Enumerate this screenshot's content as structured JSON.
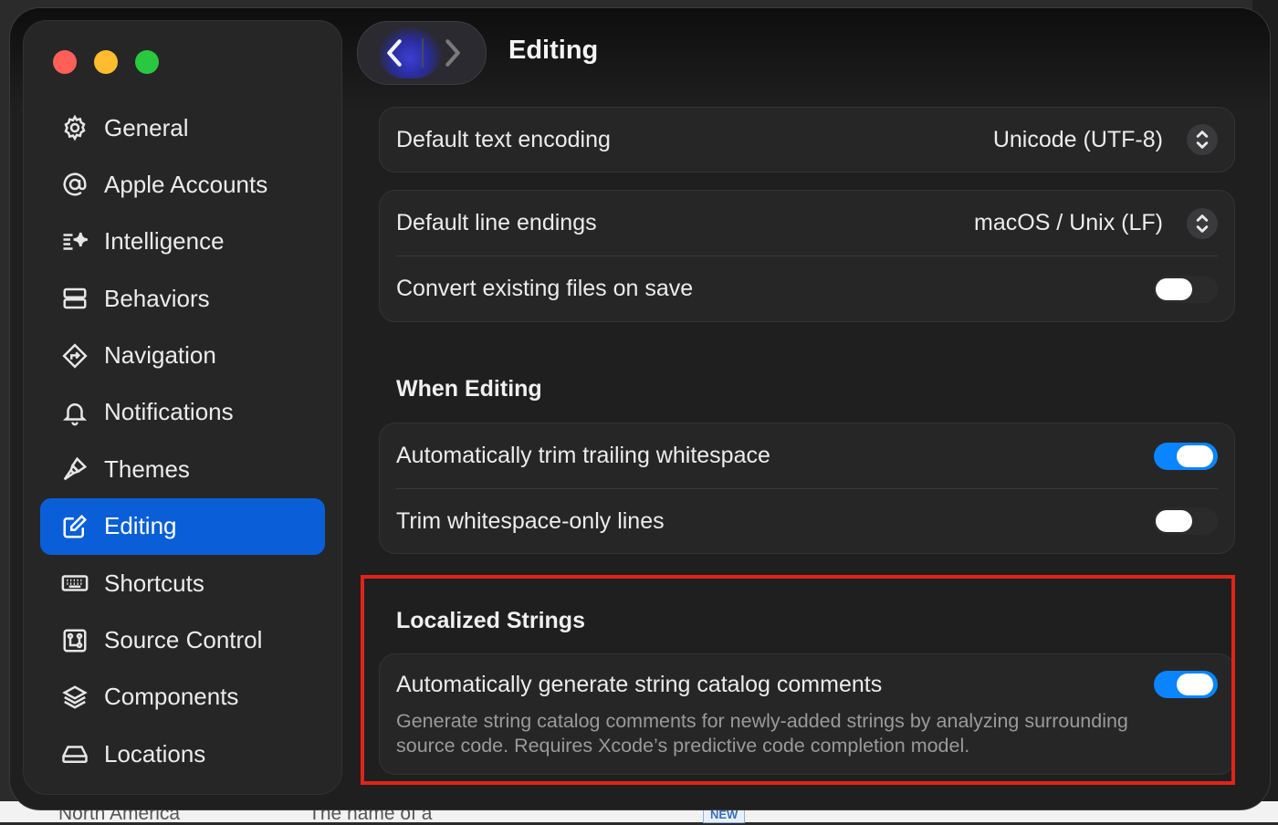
{
  "background_app": {
    "text_left": "North America",
    "text_middle": "The name of a",
    "badge": "NEW"
  },
  "window": {
    "title": "Editing"
  },
  "sidebar": {
    "items": [
      {
        "label": "General",
        "icon": "gear-icon"
      },
      {
        "label": "Apple Accounts",
        "icon": "at-sign-icon"
      },
      {
        "label": "Intelligence",
        "icon": "sparkle-icon"
      },
      {
        "label": "Behaviors",
        "icon": "behaviors-icon"
      },
      {
        "label": "Navigation",
        "icon": "navigation-icon"
      },
      {
        "label": "Notifications",
        "icon": "bell-icon"
      },
      {
        "label": "Themes",
        "icon": "paintbrush-icon"
      },
      {
        "label": "Editing",
        "icon": "edit-icon",
        "selected": true
      },
      {
        "label": "Shortcuts",
        "icon": "keyboard-icon"
      },
      {
        "label": "Source Control",
        "icon": "source-control-icon"
      },
      {
        "label": "Components",
        "icon": "layers-icon"
      },
      {
        "label": "Locations",
        "icon": "drive-icon"
      }
    ]
  },
  "settings": {
    "text_encoding": {
      "label": "Default text encoding",
      "value": "Unicode (UTF-8)"
    },
    "line_endings": {
      "label": "Default line endings",
      "value": "macOS / Unix (LF)"
    },
    "convert_on_save": {
      "label": "Convert existing files on save",
      "enabled": false
    },
    "when_editing": {
      "heading": "When Editing",
      "trim_trailing": {
        "label": "Automatically trim trailing whitespace",
        "enabled": true
      },
      "trim_whitespace_only": {
        "label": "Trim whitespace-only lines",
        "enabled": false
      }
    },
    "localized_strings": {
      "heading": "Localized Strings",
      "generate_comments": {
        "label": "Automatically generate string catalog comments",
        "enabled": true,
        "description_line1": "Generate string catalog comments for newly-added strings by analyzing surrounding",
        "description_line2": "source code. Requires Xcode’s predictive code completion model."
      }
    }
  },
  "colors": {
    "accent": "#0a84ff",
    "selection": "#0a5fd8",
    "highlight": "#e0241a"
  }
}
